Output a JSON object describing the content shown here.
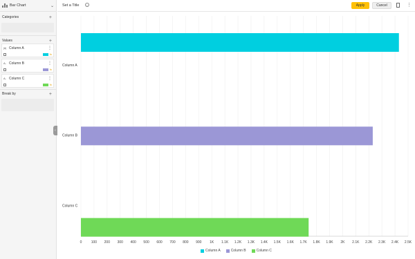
{
  "panel": {
    "chart_type_label": "Bar Chart",
    "categories_label": "Categories",
    "values_label": "Values",
    "break_by_label": "Break by",
    "values": [
      {
        "agg": "|#|",
        "name": "Column A",
        "color": "#00cfe0",
        "fx": "fx"
      },
      {
        "agg": "A-",
        "name": "Column B",
        "color": "#9b97d6",
        "fx": "fx"
      },
      {
        "agg": "A-",
        "name": "Column C",
        "color": "#6fd957",
        "fx": "fx"
      }
    ]
  },
  "toolbar": {
    "title_placeholder": "Set a Title",
    "apply_label": "Apply",
    "cancel_label": "Cancel"
  },
  "chart_data": {
    "type": "bar",
    "orientation": "horizontal",
    "categories": [
      "Column A",
      "Column B",
      "Column C"
    ],
    "values": [
      2430,
      2230,
      1740
    ],
    "colors": [
      "#00cfe0",
      "#9b97d6",
      "#6fd957"
    ],
    "xlim": [
      0,
      2500
    ],
    "x_ticks": [
      "0",
      "100",
      "200",
      "300",
      "400",
      "500",
      "600",
      "700",
      "800",
      "900",
      "1K",
      "1.1K",
      "1.2K",
      "1.3K",
      "1.4K",
      "1.5K",
      "1.6K",
      "1.7K",
      "1.8K",
      "1.9K",
      "2K",
      "2.1K",
      "2.2K",
      "2.3K",
      "2.4K",
      "2.5K"
    ],
    "grid": true,
    "legend_position": "bottom",
    "legend": [
      "Column A",
      "Column B",
      "Column C"
    ]
  }
}
